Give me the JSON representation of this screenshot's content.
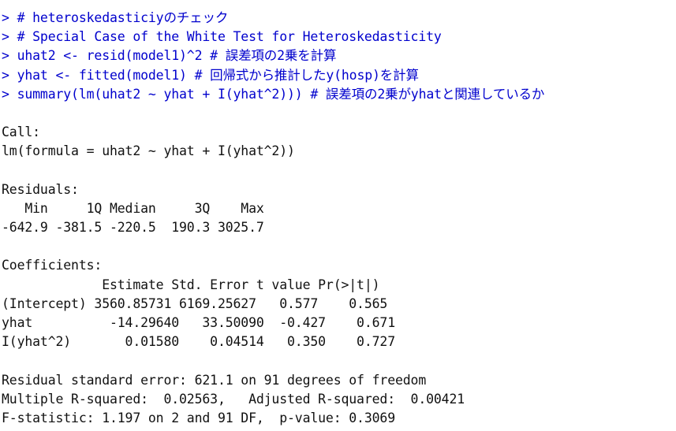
{
  "console": {
    "app": "R Console",
    "prompt": ">",
    "colors": {
      "command": "#0000cd",
      "output": "#111111",
      "background": "#ffffff"
    },
    "lines": [
      {
        "type": "command",
        "text": "> #"
      },
      {
        "type": "command",
        "text": "> # heteroskedasticiyのチェック"
      },
      {
        "type": "command",
        "text": "> # Special Case of the White Test for Heteroskedasticity"
      },
      {
        "type": "command",
        "text": "> uhat2 <- resid(model1)^2 # 誤差項の2乗を計算"
      },
      {
        "type": "command",
        "text": "> yhat <- fitted(model1) # 回帰式から推計したy(hosp)を計算"
      },
      {
        "type": "command",
        "text": "> summary(lm(uhat2 ~ yhat + I(yhat^2))) # 誤差項の2乗がyhatと関連しているか"
      },
      {
        "type": "blank",
        "text": " "
      },
      {
        "type": "output",
        "text": "Call:"
      },
      {
        "type": "output",
        "text": "lm(formula = uhat2 ~ yhat + I(yhat^2))"
      },
      {
        "type": "blank",
        "text": " "
      },
      {
        "type": "output",
        "text": "Residuals:"
      },
      {
        "type": "output",
        "text": "   Min     1Q Median     3Q    Max"
      },
      {
        "type": "output",
        "text": "-642.9 -381.5 -220.5  190.3 3025.7"
      },
      {
        "type": "blank",
        "text": " "
      },
      {
        "type": "output",
        "text": "Coefficients:"
      },
      {
        "type": "output",
        "text": "             Estimate Std. Error t value Pr(>|t|)"
      },
      {
        "type": "output",
        "text": "(Intercept) 3560.85731 6169.25627   0.577    0.565"
      },
      {
        "type": "output",
        "text": "yhat          -14.29640   33.50090  -0.427    0.671"
      },
      {
        "type": "output",
        "text": "I(yhat^2)       0.01580    0.04514   0.350    0.727"
      },
      {
        "type": "blank",
        "text": " "
      },
      {
        "type": "output",
        "text": "Residual standard error: 621.1 on 91 degrees of freedom"
      },
      {
        "type": "output",
        "text": "Multiple R-squared:  0.02563,   Adjusted R-squared:  0.00421"
      },
      {
        "type": "output",
        "text": "F-statistic: 1.197 on 2 and 91 DF,  p-value: 0.3069"
      }
    ]
  },
  "model": {
    "call_formula": "lm(formula = uhat2 ~ yhat + I(yhat^2))",
    "residuals": {
      "headers": [
        "Min",
        "1Q",
        "Median",
        "3Q",
        "Max"
      ],
      "values": [
        "-642.9",
        "-381.5",
        "-220.5",
        "190.3",
        "3025.7"
      ]
    },
    "coefficients": {
      "headers": [
        "",
        "Estimate",
        "Std. Error",
        "t value",
        "Pr(>|t|)"
      ],
      "rows": [
        {
          "term": "(Intercept)",
          "estimate": "3560.85731",
          "std_error": "6169.25627",
          "t_value": "0.577",
          "p_value": "0.565"
        },
        {
          "term": "yhat",
          "estimate": "-14.29640",
          "std_error": "33.50090",
          "t_value": "-0.427",
          "p_value": "0.671"
        },
        {
          "term": "I(yhat^2)",
          "estimate": "0.01580",
          "std_error": "0.04514",
          "t_value": "0.350",
          "p_value": "0.727"
        }
      ]
    },
    "residual_standard_error": "621.1",
    "residual_df": "91",
    "multiple_r_squared": "0.02563",
    "adjusted_r_squared": "0.00421",
    "f_statistic": "1.197",
    "f_df1": "2",
    "f_df2": "91",
    "p_value": "0.3069"
  }
}
